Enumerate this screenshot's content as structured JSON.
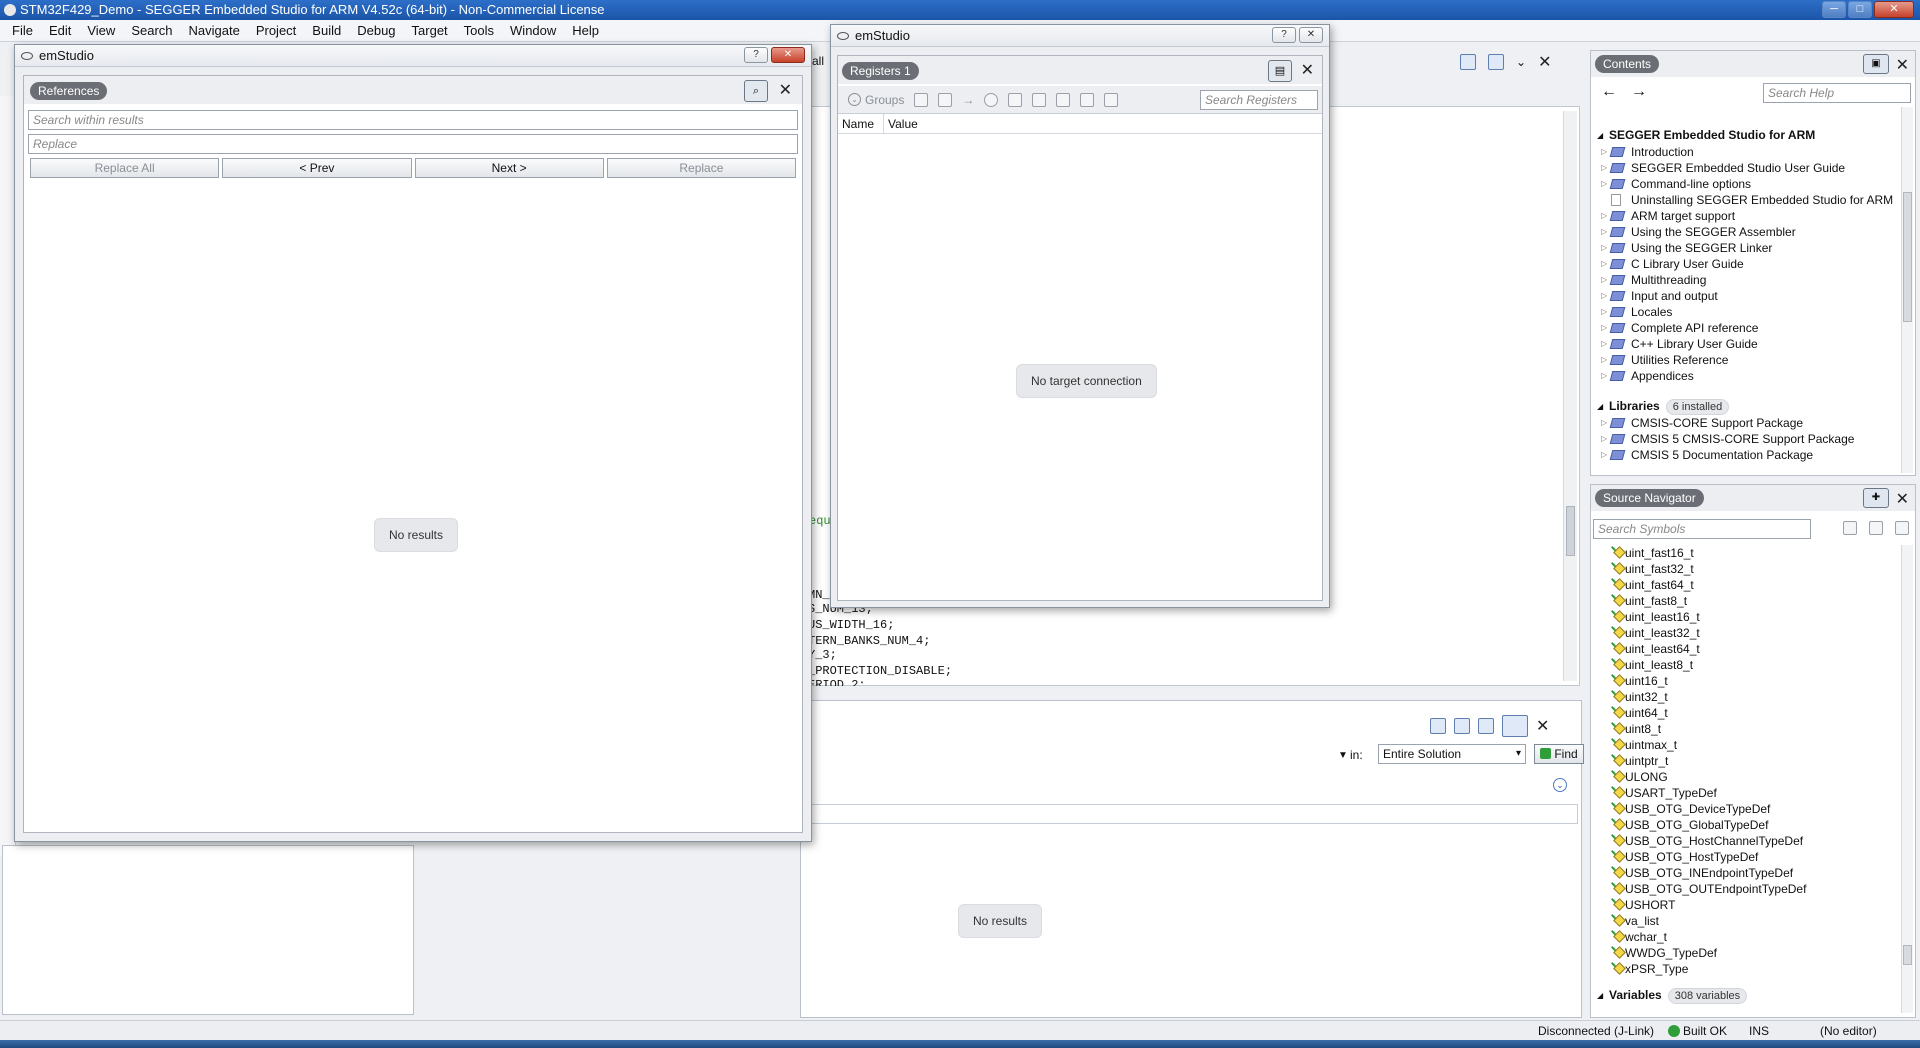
{
  "window": {
    "title": "STM32F429_Demo - SEGGER Embedded Studio for ARM V4.52c (64-bit) - Non-Commercial License",
    "min": "─",
    "max": "□",
    "close": "✕"
  },
  "menu": [
    "File",
    "Edit",
    "View",
    "Search",
    "Navigate",
    "Project",
    "Build",
    "Debug",
    "Target",
    "Tools",
    "Window",
    "Help"
  ],
  "editor": {
    "code_lines": [
      "MN_",
      "S_NUM_13;",
      "US_WIDTH_16;",
      "TERN_BANKS_NUM_4;",
      "Y_3;",
      "_PROTECTION_DISABLE;",
      "ERIOD_2;"
    ],
    "fragment_equ": "equ",
    "fragment_all": "all"
  },
  "references_window": {
    "title": "emStudio",
    "help_btn": "?",
    "close_btn": "✕",
    "panel_label": "References",
    "search_placeholder": "Search within results",
    "replace_placeholder": "Replace",
    "buttons": {
      "replace_all": "Replace All",
      "prev": "< Prev",
      "next": "Next >",
      "replace": "Replace"
    },
    "empty_text": "No results"
  },
  "registers_window": {
    "title": "emStudio",
    "help_btn": "?",
    "close_btn": "✕",
    "panel_label": "Registers 1",
    "groups_label": "Groups",
    "search_placeholder": "Search Registers",
    "columns": [
      "Name",
      "Value"
    ],
    "empty_text": "No target connection"
  },
  "find_panel": {
    "in_label": "in:",
    "scope": "Entire Solution",
    "find_button": "Find",
    "empty_text": "No results"
  },
  "help_panel": {
    "title": "Contents",
    "search_placeholder": "Search Help",
    "back": "←",
    "forward": "→",
    "section_main": "SEGGER Embedded Studio for ARM",
    "items": [
      "Introduction",
      "SEGGER Embedded Studio User Guide",
      "Command-line options",
      "Uninstalling SEGGER Embedded Studio for ARM",
      "ARM target support",
      "Using the SEGGER Assembler",
      "Using the SEGGER Linker",
      "C Library User Guide",
      "Multithreading",
      "Input and output",
      "Locales",
      "Complete API reference",
      "C++ Library User Guide",
      "Utilities Reference",
      "Appendices"
    ],
    "section_libraries": "Libraries",
    "libraries_badge": "6 installed",
    "libraries": [
      "CMSIS-CORE Support Package",
      "CMSIS 5 CMSIS-CORE Support Package",
      "CMSIS 5 Documentation Package"
    ]
  },
  "source_navigator": {
    "title": "Source Navigator",
    "search_placeholder": "Search Symbols",
    "symbols": [
      "uint_fast16_t",
      "uint_fast32_t",
      "uint_fast64_t",
      "uint_fast8_t",
      "uint_least16_t",
      "uint_least32_t",
      "uint_least64_t",
      "uint_least8_t",
      "uint16_t",
      "uint32_t",
      "uint64_t",
      "uint8_t",
      "uintmax_t",
      "uintptr_t",
      "ULONG",
      "USART_TypeDef",
      "USB_OTG_DeviceTypeDef",
      "USB_OTG_GlobalTypeDef",
      "USB_OTG_HostChannelTypeDef",
      "USB_OTG_HostTypeDef",
      "USB_OTG_INEndpointTypeDef",
      "USB_OTG_OUTEndpointTypeDef",
      "USHORT",
      "va_list",
      "wchar_t",
      "WWDG_TypeDef",
      "xPSR_Type"
    ],
    "section_variables": "Variables",
    "variables_badge": "308 variables"
  },
  "status": {
    "connection": "Disconnected (J-Link)",
    "build": "Built OK",
    "mode": "INS",
    "editor": "(No editor)"
  },
  "icons": {
    "close": "✕",
    "chevron": "⌄",
    "arrow": "→",
    "binoculars": "🔭"
  }
}
